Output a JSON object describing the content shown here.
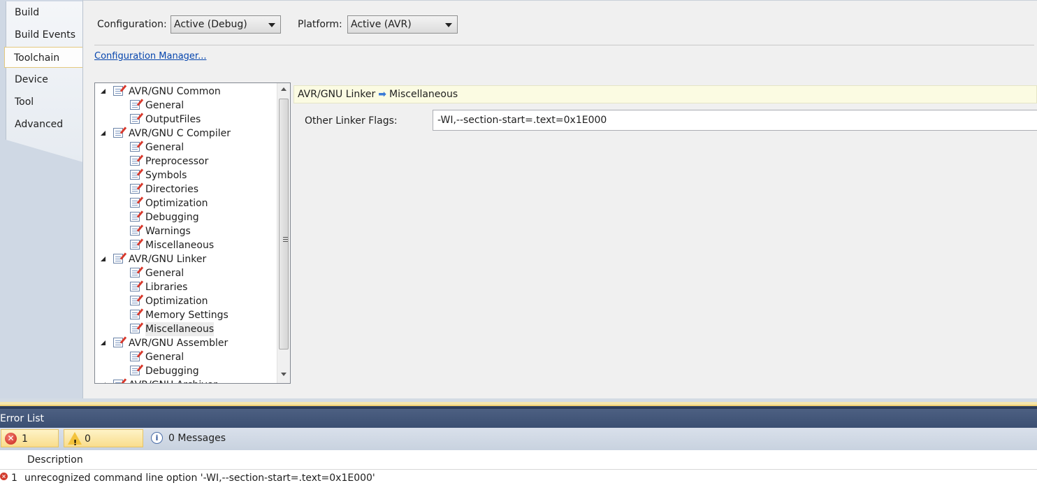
{
  "tabs": [
    {
      "label": "Build",
      "active": false
    },
    {
      "label": "Build Events",
      "active": false
    },
    {
      "label": "Toolchain",
      "active": true
    },
    {
      "label": "Device",
      "active": false
    },
    {
      "label": "Tool",
      "active": false
    },
    {
      "label": "Advanced",
      "active": false
    }
  ],
  "config": {
    "configuration_label": "Configuration:",
    "configuration_value": "Active (Debug)",
    "platform_label": "Platform:",
    "platform_value": "Active (AVR)",
    "manager_link": "Configuration Manager..."
  },
  "tree": {
    "items": [
      {
        "label": "AVR/GNU Common",
        "level": 0
      },
      {
        "label": "General",
        "level": 1
      },
      {
        "label": "OutputFiles",
        "level": 1
      },
      {
        "label": "AVR/GNU C Compiler",
        "level": 0
      },
      {
        "label": "General",
        "level": 1
      },
      {
        "label": "Preprocessor",
        "level": 1
      },
      {
        "label": "Symbols",
        "level": 1
      },
      {
        "label": "Directories",
        "level": 1
      },
      {
        "label": "Optimization",
        "level": 1
      },
      {
        "label": "Debugging",
        "level": 1
      },
      {
        "label": "Warnings",
        "level": 1
      },
      {
        "label": "Miscellaneous",
        "level": 1
      },
      {
        "label": "AVR/GNU Linker",
        "level": 0
      },
      {
        "label": "General",
        "level": 1
      },
      {
        "label": "Libraries",
        "level": 1
      },
      {
        "label": "Optimization",
        "level": 1
      },
      {
        "label": "Memory Settings",
        "level": 1
      },
      {
        "label": "Miscellaneous",
        "level": 1,
        "selected": true
      },
      {
        "label": "AVR/GNU Assembler",
        "level": 0
      },
      {
        "label": "General",
        "level": 1
      },
      {
        "label": "Debugging",
        "level": 1
      },
      {
        "label": "AVR/GNU Archiver",
        "level": 0
      }
    ]
  },
  "property_page": {
    "breadcrumb_parent": "AVR/GNU Linker",
    "breadcrumb_arrow": "➡",
    "breadcrumb_child": "Miscellaneous",
    "flags_label": "Other Linker Flags:",
    "flags_value": "-WI,--section-start=.text=0x1E000"
  },
  "error_list": {
    "title": "Error List",
    "errors_button": "1 Error",
    "warnings_button": "0 Warnings",
    "messages_button": "0 Messages",
    "column_description": "Description",
    "rows": [
      {
        "index": "1",
        "description": "unrecognized command line option '-WI,--section-start=.text=0x1E000'"
      }
    ]
  },
  "colors": {
    "accent_tab_border": "#e4c97f",
    "link": "#0645ad",
    "error_title_bar": "#3b4f72",
    "breadcrumb_bg": "#fbfbe2"
  }
}
